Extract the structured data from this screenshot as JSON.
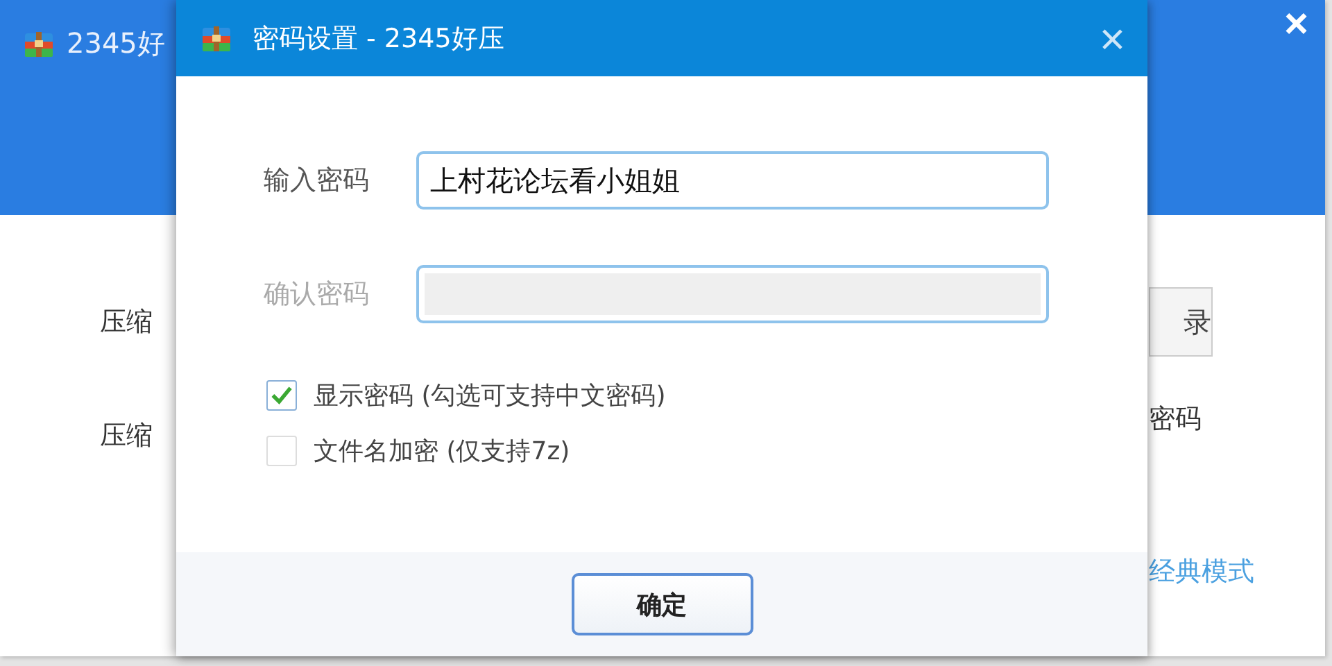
{
  "background_window": {
    "title": "2345好",
    "close": "×",
    "labels": [
      "压缩",
      "压缩"
    ],
    "button": "录",
    "right_text": "密码",
    "link": "经典模式"
  },
  "dialog": {
    "title": "密码设置 - 2345好压",
    "close": "×",
    "fields": [
      {
        "label": "输入密码",
        "value": "上村花论坛看小姐姐",
        "disabled": false
      },
      {
        "label": "确认密码",
        "disabled": true
      }
    ],
    "checkboxes": [
      {
        "label": "显示密码 (勾选可支持中文密码)",
        "checked": true,
        "disabled": false
      },
      {
        "label": "文件名加密 (仅支持7z)",
        "checked": false,
        "disabled": true
      }
    ],
    "button": "确定"
  }
}
